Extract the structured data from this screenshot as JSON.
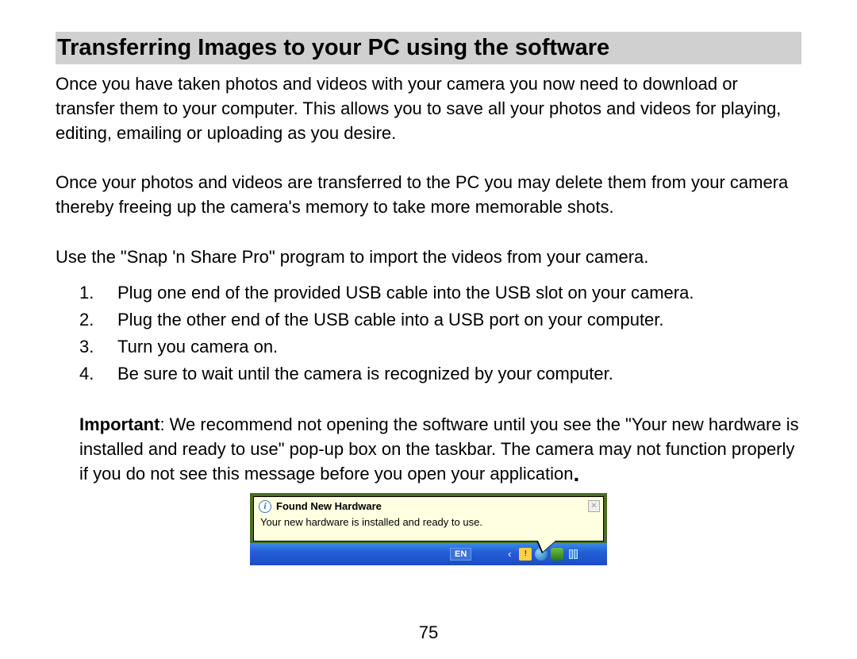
{
  "heading": "Transferring Images to your PC using the software",
  "para1": "Once you have taken photos and videos with your camera you now need to download or transfer them to your computer. This allows you to save all your photos and videos for playing, editing, emailing or uploading as you desire.",
  "para2": "Once your photos and videos are transferred to the PC you may delete them from your camera thereby freeing up the camera's memory to take more memorable shots.",
  "para3": "Use the \"Snap 'n Share Pro\" program to import the videos from your camera.",
  "list": [
    {
      "num": "1.",
      "text": "Plug one end of the provided USB cable into the USB slot on your camera."
    },
    {
      "num": "2.",
      "text": "Plug the other end of the USB cable into a USB port on your computer."
    },
    {
      "num": "3.",
      "text": "Turn you camera on."
    },
    {
      "num": "4.",
      "text": "Be sure to wait until the camera is recognized by your computer."
    }
  ],
  "important": {
    "label": "Important",
    "text": ":  We recommend not opening the software until you see the \"Your new hardware is installed and ready to use\" pop-up box on the taskbar. The camera may not function properly if you do not see this message before you open your application"
  },
  "popup": {
    "title": "Found New Hardware",
    "body": "Your new hardware is installed and ready to use.",
    "close": "×",
    "lang": "EN"
  },
  "page_number": "75"
}
